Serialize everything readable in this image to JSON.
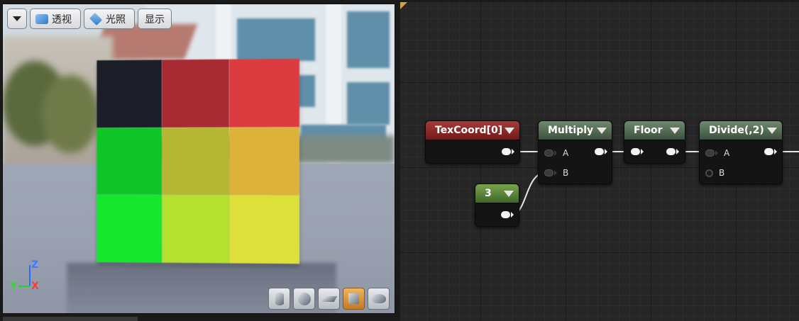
{
  "viewport": {
    "menu_dropdown": "",
    "buttons": [
      {
        "label": "透视",
        "icon": "perspective-icon"
      },
      {
        "label": "光照",
        "icon": "lit-cube-icon"
      },
      {
        "label": "显示"
      }
    ],
    "axes": {
      "z": "Z",
      "y": "Y",
      "x": "X"
    },
    "checker_colors": [
      "#1b1e26",
      "#a82a33",
      "#dc3c3f",
      "#0fc527",
      "#b5b734",
      "#dcb23a",
      "#14e72e",
      "#b4e02f",
      "#dde03a"
    ],
    "preview_shapes": [
      {
        "name": "cylinder-preview-icon",
        "active": false
      },
      {
        "name": "sphere-preview-icon",
        "active": false
      },
      {
        "name": "plane-preview-icon",
        "active": false
      },
      {
        "name": "cube-preview-icon",
        "active": true
      },
      {
        "name": "teapot-preview-icon",
        "active": false
      }
    ]
  },
  "graph": {
    "nodes": {
      "texcoord": {
        "title": "TexCoord[0]"
      },
      "constant": {
        "title": "3"
      },
      "multiply": {
        "title": "Multiply",
        "pin_a": "A",
        "pin_b": "B"
      },
      "floor": {
        "title": "Floor"
      },
      "divide": {
        "title": "Divide(,2)",
        "pin_a": "A",
        "pin_b": "B"
      }
    }
  }
}
